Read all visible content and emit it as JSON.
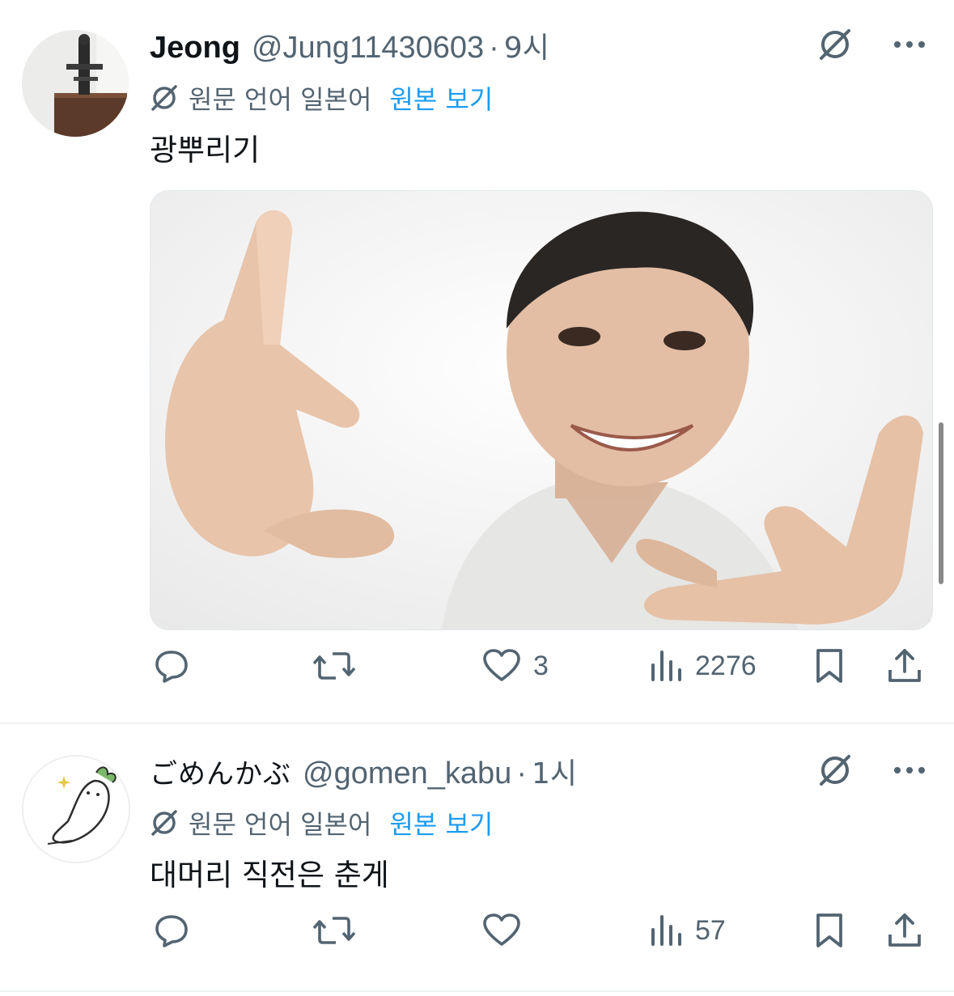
{
  "tweets": [
    {
      "name": "Jeong",
      "handle": "@Jung11430603",
      "separator": "·",
      "time": "9시",
      "translation_note": "원문 언어 일본어",
      "view_original": "원본 보기",
      "text": "광뿌리기",
      "media_description": "photo",
      "actions": {
        "reply": "",
        "retweet": "",
        "like": "3",
        "views": "2276"
      }
    },
    {
      "name": "ごめんかぶ",
      "handle": "@gomen_kabu",
      "separator": "·",
      "time": "1시",
      "translation_note": "원문 언어 일본어",
      "view_original": "원본 보기",
      "text": "대머리 직전은 춘게",
      "actions": {
        "reply": "",
        "retweet": "",
        "like": "",
        "views": "57"
      }
    }
  ],
  "icons": {
    "translate": "translate-slash-icon",
    "more": "more-icon",
    "reply": "reply-icon",
    "retweet": "retweet-icon",
    "like": "heart-icon",
    "views": "views-icon",
    "bookmark": "bookmark-icon",
    "share": "share-icon"
  },
  "colors": {
    "link": "#1d9bf0",
    "muted": "#536471",
    "text": "#0f1419"
  }
}
